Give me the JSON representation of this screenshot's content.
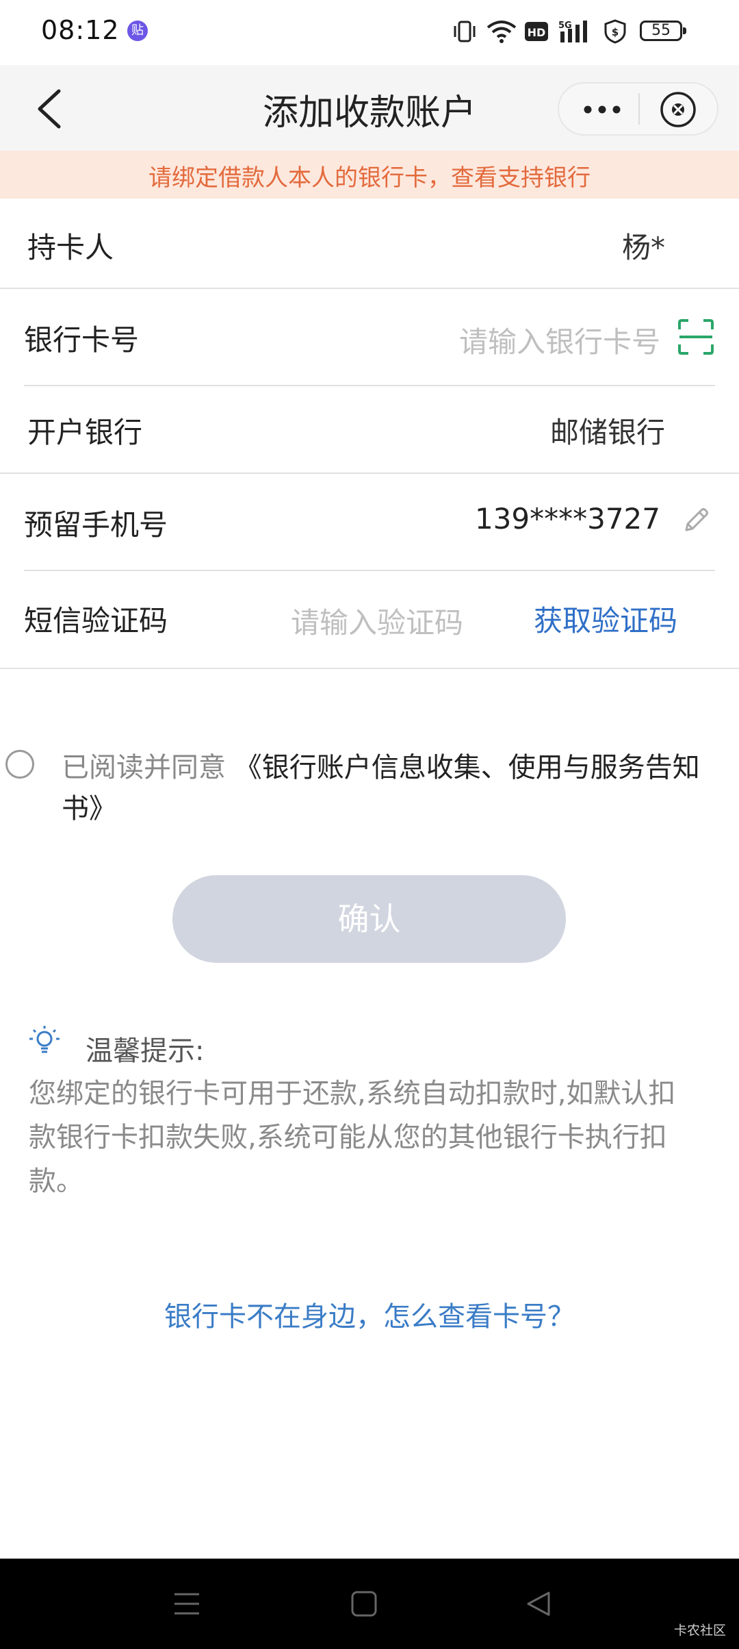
{
  "status_bar": {
    "time": "08:12",
    "app_badge": "贴",
    "battery": "55"
  },
  "header": {
    "title": "添加收款账户"
  },
  "notice": {
    "text": "请绑定借款人本人的银行卡，查看支持银行"
  },
  "form": {
    "holder": {
      "label": "持卡人",
      "value": "杨*"
    },
    "card_number": {
      "label": "银行卡号",
      "placeholder": "请输入银行卡号"
    },
    "bank": {
      "label": "开户银行",
      "value": "邮储银行"
    },
    "phone": {
      "label": "预留手机号",
      "value": "139****3727"
    },
    "sms": {
      "label": "短信验证码",
      "placeholder": "请输入验证码",
      "action": "获取验证码"
    }
  },
  "agreement": {
    "prefix": "已阅读并同意",
    "link_part1": "《银行账户信息收集、使用与服务告知",
    "link_part2": "书》"
  },
  "confirm_label": "确认",
  "tip": {
    "title": "温馨提示:",
    "body": "您绑定的银行卡可用于还款,系统自动扣款时,如默认扣款银行卡扣款失败,系统可能从您的其他银行卡执行扣款。"
  },
  "help_link": "银行卡不在身边，怎么查看卡号？",
  "watermark": "卡农社区",
  "colors": {
    "accent": "#2f6fc7",
    "notice_bg": "#fde8de",
    "notice_text": "#e36a3c",
    "scan_green": "#2aa66a",
    "confirm_disabled": "#d1d5df"
  }
}
